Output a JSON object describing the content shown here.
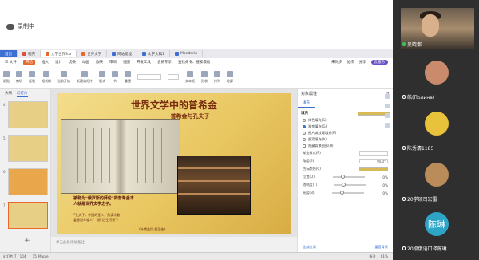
{
  "recording": {
    "label": "录制中"
  },
  "tabs": [
    {
      "label": "首页"
    },
    {
      "label": "稻壳"
    },
    {
      "label": "文学世界3.b"
    },
    {
      "label": "世界文学"
    },
    {
      "label": "网站建设"
    },
    {
      "label": "文字文稿1"
    },
    {
      "label": "Mandarin"
    }
  ],
  "menubar": {
    "file": "三 文件",
    "start": "开始",
    "items": [
      "插入",
      "设计",
      "切换",
      "动画",
      "放映",
      "审阅",
      "视图",
      "开发工具",
      "会员专享",
      "查找命令、搜索模板"
    ],
    "right": [
      "未同步",
      "协作",
      "分享"
    ],
    "cloud": "云服务"
  },
  "toolbar": {
    "items": [
      "粘贴",
      "剪切",
      "复制",
      "格式刷",
      "当前开始",
      "新建幻灯片",
      "版式",
      "节",
      "重置",
      "字体",
      "字号",
      "文本框",
      "形状",
      "排列",
      "轮廓"
    ]
  },
  "sidebar": {
    "tab_outline": "大纲",
    "tab_slides": "幻灯片",
    "numbers": [
      "4",
      "5",
      "6",
      "7"
    ],
    "add": "+"
  },
  "slide": {
    "title": "世界文学中的普希金",
    "subtitle": "普希金与孔夫子",
    "caption_line1": "被称为“俄罗斯的拜伦”的普希金本",
    "caption_line2": "人就是世界文学之子。",
    "quote_line1": "“孔夫子，中国的圣人，熟读诗歌",
    "quote_line2": "爱香港年轻人”（即“后生可畏”）",
    "footer": "《叶甫盖尼·奥涅金》"
  },
  "notes": {
    "placeholder": "单击此处添加备注"
  },
  "panel": {
    "title": "对象属性",
    "tab": "填充",
    "fill_label": "填充",
    "fill_options": [
      "纯色填充(S)",
      "渐变填充(G)",
      "图片或纹理填充(P)",
      "图案填充(A)",
      "隐藏背景图形(H)"
    ],
    "fill_selected_index": 1,
    "rows": [
      {
        "label": "渐变样式(R)",
        "value": ""
      },
      {
        "label": "角度(E)",
        "value": "90.0°"
      },
      {
        "label": "色标颜色(C)",
        "value": ""
      },
      {
        "label": "位置(O)",
        "value": "0%"
      },
      {
        "label": "透明度(T)",
        "value": "0%"
      },
      {
        "label": "亮度(B)",
        "value": "0%"
      }
    ],
    "apply_all": "全部应用",
    "reset": "重置背景"
  },
  "status": {
    "slide": "幻灯片 7 / 104",
    "theme": "15_Maple",
    "notes": "备注",
    "zoom": "61%"
  },
  "participants": [
    {
      "name": "吴晓都",
      "type": "video",
      "mic_on": true
    },
    {
      "name": "皓(Полина)",
      "type": "avatar",
      "mic_on": false,
      "avatar_color": "#c98b6b"
    },
    {
      "name": "陈秀清1185",
      "type": "avatar",
      "mic_on": false,
      "avatar_color": "#e8c23a"
    },
    {
      "name": "20学硕司宏雷",
      "type": "avatar",
      "mic_on": false,
      "avatar_color": "#b98c5a"
    },
    {
      "name": "20级俄语口译陈琳",
      "type": "text",
      "mic_on": false,
      "avatar_text": "陈琳",
      "avatar_color": "#2ea5c6"
    }
  ],
  "colors": {
    "wps_blue": "#3c6fd1",
    "wps_orange": "#e8692b",
    "slide_title": "#7a2c0f",
    "meeting_bg": "#2f2f2f"
  }
}
